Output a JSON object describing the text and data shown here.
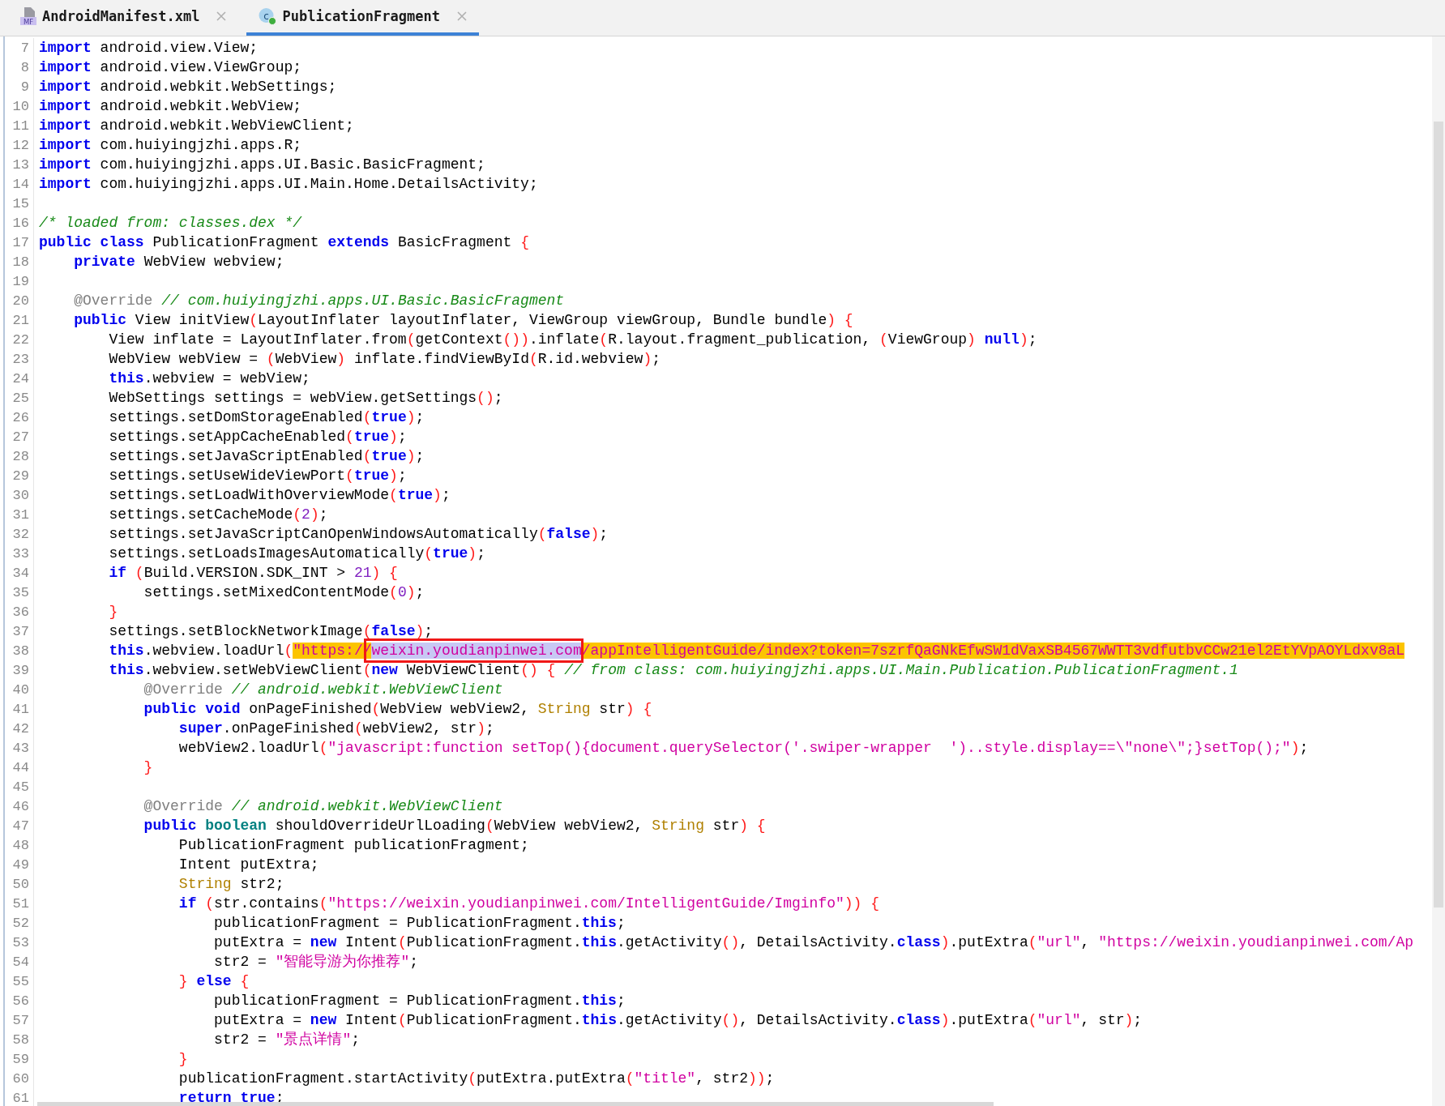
{
  "tabs": [
    {
      "label": "AndroidManifest.xml",
      "kind": "manifest",
      "icon_text": "MF",
      "selected": false
    },
    {
      "label": "PublicationFragment",
      "kind": "class",
      "icon_text": "c",
      "selected": true
    }
  ],
  "editor": {
    "lines": [
      {
        "number": "7",
        "tokens": [
          {
            "kind": "keyword",
            "text": "import"
          },
          {
            "kind": "plain",
            "text": " android.view.View;"
          }
        ]
      },
      {
        "number": "8",
        "tokens": [
          {
            "kind": "keyword",
            "text": "import"
          },
          {
            "kind": "plain",
            "text": " android.view.ViewGroup;"
          }
        ]
      },
      {
        "number": "9",
        "tokens": [
          {
            "kind": "keyword",
            "text": "import"
          },
          {
            "kind": "plain",
            "text": " android.webkit.WebSettings;"
          }
        ]
      },
      {
        "number": "10",
        "tokens": [
          {
            "kind": "keyword",
            "text": "import"
          },
          {
            "kind": "plain",
            "text": " android.webkit.WebView;"
          }
        ]
      },
      {
        "number": "11",
        "tokens": [
          {
            "kind": "keyword",
            "text": "import"
          },
          {
            "kind": "plain",
            "text": " android.webkit.WebViewClient;"
          }
        ]
      },
      {
        "number": "12",
        "tokens": [
          {
            "kind": "keyword",
            "text": "import"
          },
          {
            "kind": "plain",
            "text": " com.huiyingjzhi.apps.R;"
          }
        ]
      },
      {
        "number": "13",
        "tokens": [
          {
            "kind": "keyword",
            "text": "import"
          },
          {
            "kind": "plain",
            "text": " com.huiyingjzhi.apps.UI.Basic.BasicFragment;"
          }
        ]
      },
      {
        "number": "14",
        "tokens": [
          {
            "kind": "keyword",
            "text": "import"
          },
          {
            "kind": "plain",
            "text": " com.huiyingjzhi.apps.UI.Main.Home.DetailsActivity;"
          }
        ]
      },
      {
        "number": "15"
      },
      {
        "number": "16",
        "tokens": [
          {
            "kind": "comment",
            "text": "/* loaded from: classes.dex */"
          }
        ]
      },
      {
        "number": "17",
        "tokens": [
          {
            "kind": "keyword",
            "text": "public"
          },
          {
            "kind": "keyword",
            "text": " class"
          },
          {
            "kind": "plain",
            "text": " PublicationFragment"
          },
          {
            "kind": "keyword",
            "text": " extends"
          },
          {
            "kind": "plain",
            "text": " BasicFragment"
          },
          {
            "kind": "bracket",
            "text": " {"
          }
        ]
      },
      {
        "number": "18",
        "tokens": [
          {
            "kind": "keyword",
            "text": "    private"
          },
          {
            "kind": "plain",
            "text": " WebView webview;"
          }
        ]
      },
      {
        "number": "19"
      },
      {
        "number": "20",
        "tokens": [
          {
            "kind": "annotation",
            "text": "    @Override"
          },
          {
            "kind": "comment",
            "text": " // com.huiyingjzhi.apps.UI.Basic.BasicFragment"
          }
        ]
      },
      {
        "number": "21",
        "tokens": [
          {
            "kind": "keyword",
            "text": "    public"
          },
          {
            "kind": "plain",
            "text": " View initView"
          },
          {
            "kind": "bracket",
            "text": "("
          },
          {
            "kind": "plain",
            "text": "LayoutInflater layoutInflater, ViewGroup viewGroup, Bundle bundle"
          },
          {
            "kind": "bracket",
            "text": ") {"
          }
        ]
      },
      {
        "number": "22",
        "tokens": [
          {
            "kind": "plain",
            "text": "        View inflate = LayoutInflater.from"
          },
          {
            "kind": "bracket",
            "text": "("
          },
          {
            "kind": "plain",
            "text": "getContext"
          },
          {
            "kind": "bracket",
            "text": "())"
          },
          {
            "kind": "plain",
            "text": ".inflate"
          },
          {
            "kind": "bracket",
            "text": "("
          },
          {
            "kind": "plain",
            "text": "R.layout.fragment_publication,"
          },
          {
            "kind": "bracket",
            "text": " ("
          },
          {
            "kind": "plain",
            "text": "ViewGroup"
          },
          {
            "kind": "bracket",
            "text": ")"
          },
          {
            "kind": "keyword",
            "text": " null"
          },
          {
            "kind": "bracket",
            "text": ")"
          },
          {
            "kind": "plain",
            "text": ";"
          }
        ]
      },
      {
        "number": "23",
        "tokens": [
          {
            "kind": "plain",
            "text": "        WebView webView ="
          },
          {
            "kind": "bracket",
            "text": " ("
          },
          {
            "kind": "plain",
            "text": "WebView"
          },
          {
            "kind": "bracket",
            "text": ")"
          },
          {
            "kind": "plain",
            "text": " inflate.findViewById"
          },
          {
            "kind": "bracket",
            "text": "("
          },
          {
            "kind": "plain",
            "text": "R.id.webview"
          },
          {
            "kind": "bracket",
            "text": ")"
          },
          {
            "kind": "plain",
            "text": ";"
          }
        ]
      },
      {
        "number": "24",
        "tokens": [
          {
            "kind": "keyword",
            "text": "        this"
          },
          {
            "kind": "plain",
            "text": ".webview = webView;"
          }
        ]
      },
      {
        "number": "25",
        "tokens": [
          {
            "kind": "plain",
            "text": "        WebSettings settings = webView.getSettings"
          },
          {
            "kind": "bracket",
            "text": "()"
          },
          {
            "kind": "plain",
            "text": ";"
          }
        ]
      },
      {
        "number": "26",
        "tokens": [
          {
            "kind": "plain",
            "text": "        settings.setDomStorageEnabled"
          },
          {
            "kind": "bracket",
            "text": "("
          },
          {
            "kind": "keyword",
            "text": "true"
          },
          {
            "kind": "bracket",
            "text": ")"
          },
          {
            "kind": "plain",
            "text": ";"
          }
        ]
      },
      {
        "number": "27",
        "tokens": [
          {
            "kind": "plain",
            "text": "        settings.setAppCacheEnabled"
          },
          {
            "kind": "bracket",
            "text": "("
          },
          {
            "kind": "keyword",
            "text": "true"
          },
          {
            "kind": "bracket",
            "text": ")"
          },
          {
            "kind": "plain",
            "text": ";"
          }
        ]
      },
      {
        "number": "28",
        "tokens": [
          {
            "kind": "plain",
            "text": "        settings.setJavaScriptEnabled"
          },
          {
            "kind": "bracket",
            "text": "("
          },
          {
            "kind": "keyword",
            "text": "true"
          },
          {
            "kind": "bracket",
            "text": ")"
          },
          {
            "kind": "plain",
            "text": ";"
          }
        ]
      },
      {
        "number": "29",
        "tokens": [
          {
            "kind": "plain",
            "text": "        settings.setUseWideViewPort"
          },
          {
            "kind": "bracket",
            "text": "("
          },
          {
            "kind": "keyword",
            "text": "true"
          },
          {
            "kind": "bracket",
            "text": ")"
          },
          {
            "kind": "plain",
            "text": ";"
          }
        ]
      },
      {
        "number": "30",
        "tokens": [
          {
            "kind": "plain",
            "text": "        settings.setLoadWithOverviewMode"
          },
          {
            "kind": "bracket",
            "text": "("
          },
          {
            "kind": "keyword",
            "text": "true"
          },
          {
            "kind": "bracket",
            "text": ")"
          },
          {
            "kind": "plain",
            "text": ";"
          }
        ]
      },
      {
        "number": "31",
        "tokens": [
          {
            "kind": "plain",
            "text": "        settings.setCacheMode"
          },
          {
            "kind": "bracket",
            "text": "("
          },
          {
            "kind": "number",
            "text": "2"
          },
          {
            "kind": "bracket",
            "text": ")"
          },
          {
            "kind": "plain",
            "text": ";"
          }
        ]
      },
      {
        "number": "32",
        "tokens": [
          {
            "kind": "plain",
            "text": "        settings.setJavaScriptCanOpenWindowsAutomatically"
          },
          {
            "kind": "bracket",
            "text": "("
          },
          {
            "kind": "keyword",
            "text": "false"
          },
          {
            "kind": "bracket",
            "text": ")"
          },
          {
            "kind": "plain",
            "text": ";"
          }
        ]
      },
      {
        "number": "33",
        "tokens": [
          {
            "kind": "plain",
            "text": "        settings.setLoadsImagesAutomatically"
          },
          {
            "kind": "bracket",
            "text": "("
          },
          {
            "kind": "keyword",
            "text": "true"
          },
          {
            "kind": "bracket",
            "text": ")"
          },
          {
            "kind": "plain",
            "text": ";"
          }
        ]
      },
      {
        "number": "34",
        "tokens": [
          {
            "kind": "keyword",
            "text": "        if"
          },
          {
            "kind": "bracket",
            "text": " ("
          },
          {
            "kind": "plain",
            "text": "Build.VERSION.SDK_INT >"
          },
          {
            "kind": "number",
            "text": " 21"
          },
          {
            "kind": "bracket",
            "text": ") {"
          }
        ]
      },
      {
        "number": "35",
        "tokens": [
          {
            "kind": "plain",
            "text": "            settings.setMixedContentMode"
          },
          {
            "kind": "bracket",
            "text": "("
          },
          {
            "kind": "number",
            "text": "0"
          },
          {
            "kind": "bracket",
            "text": ")"
          },
          {
            "kind": "plain",
            "text": ";"
          }
        ]
      },
      {
        "number": "36",
        "tokens": [
          {
            "kind": "bracket",
            "text": "        }"
          }
        ]
      },
      {
        "number": "37",
        "tokens": [
          {
            "kind": "plain",
            "text": "        settings.setBlockNetworkImage"
          },
          {
            "kind": "bracket",
            "text": "("
          },
          {
            "kind": "keyword",
            "text": "false"
          },
          {
            "kind": "bracket",
            "text": ")"
          },
          {
            "kind": "plain",
            "text": ";"
          }
        ]
      },
      {
        "number": "38",
        "frame": true,
        "tokens": [
          {
            "kind": "keyword",
            "text": "        this"
          },
          {
            "kind": "plain",
            "text": ".webview.loadUrl"
          },
          {
            "kind": "bracket",
            "text": "("
          },
          {
            "kind": "highlight",
            "text": "\"https://"
          },
          {
            "kind": "selection",
            "text": "weixin.youdianpinwei.com"
          },
          {
            "kind": "highlight",
            "text": "/appIntelligentGuide/index?token=7szrfQaGNkEfwSW1dVaxSB4567WWTT3vdfutbvCCw21el2EtYVpAOYLdxv8aL"
          }
        ]
      },
      {
        "number": "39",
        "tokens": [
          {
            "kind": "keyword",
            "text": "        this"
          },
          {
            "kind": "plain",
            "text": ".webview.setWebViewClient"
          },
          {
            "kind": "bracket",
            "text": "("
          },
          {
            "kind": "keyword",
            "text": "new"
          },
          {
            "kind": "plain",
            "text": " WebViewClient"
          },
          {
            "kind": "bracket",
            "text": "() {"
          },
          {
            "kind": "comment",
            "text": " // from class: com.huiyingjzhi.apps.UI.Main.Publication.PublicationFragment.1"
          }
        ]
      },
      {
        "number": "40",
        "tokens": [
          {
            "kind": "annotation",
            "text": "            @Override"
          },
          {
            "kind": "comment",
            "text": " // android.webkit.WebViewClient"
          }
        ]
      },
      {
        "number": "41",
        "tokens": [
          {
            "kind": "keyword",
            "text": "            public"
          },
          {
            "kind": "keyword",
            "text": " void"
          },
          {
            "kind": "plain",
            "text": " onPageFinished"
          },
          {
            "kind": "bracket",
            "text": "("
          },
          {
            "kind": "plain",
            "text": "WebView webView2,"
          },
          {
            "kind": "type",
            "text": " String"
          },
          {
            "kind": "plain",
            "text": " str"
          },
          {
            "kind": "bracket",
            "text": ") {"
          }
        ]
      },
      {
        "number": "42",
        "tokens": [
          {
            "kind": "keyword",
            "text": "                super"
          },
          {
            "kind": "plain",
            "text": ".onPageFinished"
          },
          {
            "kind": "bracket",
            "text": "("
          },
          {
            "kind": "plain",
            "text": "webView2, str"
          },
          {
            "kind": "bracket",
            "text": ")"
          },
          {
            "kind": "plain",
            "text": ";"
          }
        ]
      },
      {
        "number": "43",
        "tokens": [
          {
            "kind": "plain",
            "text": "                webView2.loadUrl"
          },
          {
            "kind": "bracket",
            "text": "("
          },
          {
            "kind": "string",
            "text": "\"javascript:function setTop(){document.querySelector('.swiper-wrapper  ')..style.display==\\\"none\\\";}setTop();\""
          },
          {
            "kind": "bracket",
            "text": ")"
          },
          {
            "kind": "plain",
            "text": ";"
          }
        ]
      },
      {
        "number": "44",
        "tokens": [
          {
            "kind": "bracket",
            "text": "            }"
          }
        ]
      },
      {
        "number": "45"
      },
      {
        "number": "46",
        "tokens": [
          {
            "kind": "annotation",
            "text": "            @Override"
          },
          {
            "kind": "comment",
            "text": " // android.webkit.WebViewClient"
          }
        ]
      },
      {
        "number": "47",
        "tokens": [
          {
            "kind": "keyword",
            "text": "            public"
          },
          {
            "kind": "keyword2",
            "text": " boolean"
          },
          {
            "kind": "plain",
            "text": " shouldOverrideUrlLoading"
          },
          {
            "kind": "bracket",
            "text": "("
          },
          {
            "kind": "plain",
            "text": "WebView webView2,"
          },
          {
            "kind": "type",
            "text": " String"
          },
          {
            "kind": "plain",
            "text": " str"
          },
          {
            "kind": "bracket",
            "text": ") {"
          }
        ]
      },
      {
        "number": "48",
        "tokens": [
          {
            "kind": "plain",
            "text": "                PublicationFragment publicationFragment;"
          }
        ]
      },
      {
        "number": "49",
        "tokens": [
          {
            "kind": "plain",
            "text": "                Intent putExtra;"
          }
        ]
      },
      {
        "number": "50",
        "tokens": [
          {
            "kind": "type",
            "text": "                String"
          },
          {
            "kind": "plain",
            "text": " str2;"
          }
        ]
      },
      {
        "number": "51",
        "tokens": [
          {
            "kind": "keyword",
            "text": "                if"
          },
          {
            "kind": "bracket",
            "text": " ("
          },
          {
            "kind": "plain",
            "text": "str.contains"
          },
          {
            "kind": "bracket",
            "text": "("
          },
          {
            "kind": "string",
            "text": "\"https://weixin.youdianpinwei.com/IntelligentGuide/Imginfo\""
          },
          {
            "kind": "bracket",
            "text": ")) {"
          }
        ]
      },
      {
        "number": "52",
        "tokens": [
          {
            "kind": "plain",
            "text": "                    publicationFragment = PublicationFragment."
          },
          {
            "kind": "keyword",
            "text": "this"
          },
          {
            "kind": "plain",
            "text": ";"
          }
        ]
      },
      {
        "number": "53",
        "tokens": [
          {
            "kind": "plain",
            "text": "                    putExtra ="
          },
          {
            "kind": "keyword",
            "text": " new"
          },
          {
            "kind": "plain",
            "text": " Intent"
          },
          {
            "kind": "bracket",
            "text": "("
          },
          {
            "kind": "plain",
            "text": "PublicationFragment."
          },
          {
            "kind": "keyword",
            "text": "this"
          },
          {
            "kind": "plain",
            "text": ".getActivity"
          },
          {
            "kind": "bracket",
            "text": "()"
          },
          {
            "kind": "plain",
            "text": ", DetailsActivity."
          },
          {
            "kind": "keyword",
            "text": "class"
          },
          {
            "kind": "bracket",
            "text": ")"
          },
          {
            "kind": "plain",
            "text": ".putExtra"
          },
          {
            "kind": "bracket",
            "text": "("
          },
          {
            "kind": "string",
            "text": "\"url\""
          },
          {
            "kind": "plain",
            "text": ","
          },
          {
            "kind": "string",
            "text": " \"https://weixin.youdianpinwei.com/Ap"
          }
        ]
      },
      {
        "number": "54",
        "tokens": [
          {
            "kind": "plain",
            "text": "                    str2 ="
          },
          {
            "kind": "string",
            "text": " \"智能导游为你推荐\""
          },
          {
            "kind": "plain",
            "text": ";"
          }
        ]
      },
      {
        "number": "55",
        "tokens": [
          {
            "kind": "bracket",
            "text": "                }"
          },
          {
            "kind": "keyword",
            "text": " else"
          },
          {
            "kind": "bracket",
            "text": " {"
          }
        ]
      },
      {
        "number": "56",
        "tokens": [
          {
            "kind": "plain",
            "text": "                    publicationFragment = PublicationFragment."
          },
          {
            "kind": "keyword",
            "text": "this"
          },
          {
            "kind": "plain",
            "text": ";"
          }
        ]
      },
      {
        "number": "57",
        "tokens": [
          {
            "kind": "plain",
            "text": "                    putExtra ="
          },
          {
            "kind": "keyword",
            "text": " new"
          },
          {
            "kind": "plain",
            "text": " Intent"
          },
          {
            "kind": "bracket",
            "text": "("
          },
          {
            "kind": "plain",
            "text": "PublicationFragment."
          },
          {
            "kind": "keyword",
            "text": "this"
          },
          {
            "kind": "plain",
            "text": ".getActivity"
          },
          {
            "kind": "bracket",
            "text": "()"
          },
          {
            "kind": "plain",
            "text": ", DetailsActivity."
          },
          {
            "kind": "keyword",
            "text": "class"
          },
          {
            "kind": "bracket",
            "text": ")"
          },
          {
            "kind": "plain",
            "text": ".putExtra"
          },
          {
            "kind": "bracket",
            "text": "("
          },
          {
            "kind": "string",
            "text": "\"url\""
          },
          {
            "kind": "plain",
            "text": ", str"
          },
          {
            "kind": "bracket",
            "text": ")"
          },
          {
            "kind": "plain",
            "text": ";"
          }
        ]
      },
      {
        "number": "58",
        "tokens": [
          {
            "kind": "plain",
            "text": "                    str2 ="
          },
          {
            "kind": "string",
            "text": " \"景点详情\""
          },
          {
            "kind": "plain",
            "text": ";"
          }
        ]
      },
      {
        "number": "59",
        "tokens": [
          {
            "kind": "bracket",
            "text": "                }"
          }
        ]
      },
      {
        "number": "60",
        "tokens": [
          {
            "kind": "plain",
            "text": "                publicationFragment.startActivity"
          },
          {
            "kind": "bracket",
            "text": "("
          },
          {
            "kind": "plain",
            "text": "putExtra.putExtra"
          },
          {
            "kind": "bracket",
            "text": "("
          },
          {
            "kind": "string",
            "text": "\"title\""
          },
          {
            "kind": "plain",
            "text": ", str2"
          },
          {
            "kind": "bracket",
            "text": "))"
          },
          {
            "kind": "plain",
            "text": ";"
          }
        ]
      },
      {
        "number": "61",
        "tokens": [
          {
            "kind": "keyword",
            "text": "                return"
          },
          {
            "kind": "keyword",
            "text": " true"
          },
          {
            "kind": "plain",
            "text": ";"
          }
        ]
      }
    ]
  }
}
